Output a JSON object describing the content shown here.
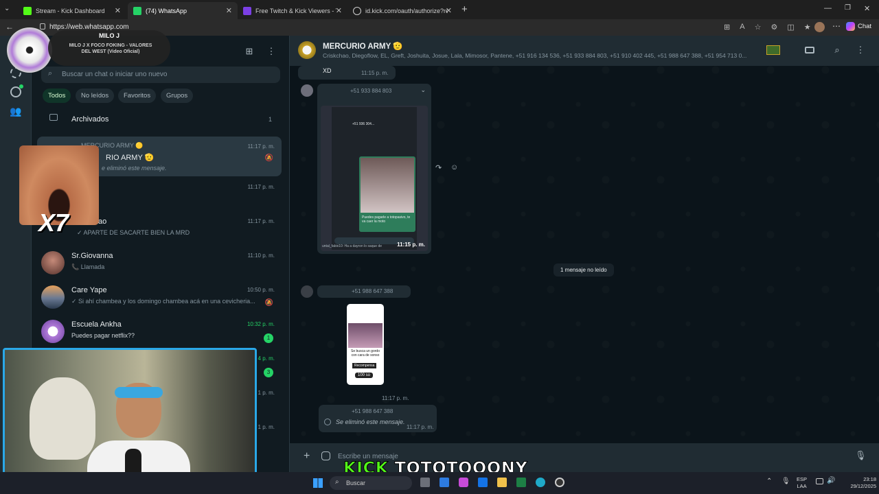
{
  "browser": {
    "tabs": [
      {
        "label": "Stream - Kick Dashboard",
        "color": "#53fc18"
      },
      {
        "label": "(74) WhatsApp",
        "color": "#25d366"
      },
      {
        "label": "Free Twitch & Kick Viewers - Try 1:",
        "color": "#7b3fe4"
      },
      {
        "label": "id.kick.com/oauth/authorize?resp",
        "color": "#cfcfcf"
      }
    ],
    "url": "https://web.whatsapp.com",
    "chat_label": "Chat"
  },
  "sidebar": {
    "search_placeholder": "Buscar un chat o iniciar uno nuevo",
    "filters": [
      "Todos",
      "No leídos",
      "Favoritos",
      "Grupos"
    ],
    "archived_label": "Archivados",
    "archived_count": "1",
    "chats": [
      {
        "group_label": "MERCURIO ARMY 🟡",
        "name": "RIO ARMY 🫡",
        "preview": "e eliminó este mensaje.",
        "time": "11:17 p. m."
      },
      {
        "name": "",
        "preview": "",
        "time": "11:17 p. m."
      },
      {
        "name": "iskchao",
        "preview": "✓ APARTE DE SACARTE BIEN LA MRD",
        "time": "11:17 p. m."
      },
      {
        "name": "Sr.Giovanna",
        "preview": "📞 Llamada",
        "time": "11:10 p. m."
      },
      {
        "name": "Care Yape",
        "preview": "✓ Si ahí chambea y los domingo chambea acá en una cevicheria...",
        "time": "10:50 p. m."
      },
      {
        "name": "Escuela Ankha",
        "preview": "Puedes pagar netflix??",
        "time": "10:32 p. m.",
        "unread": "1"
      },
      {
        "name": "",
        "preview": "",
        "time": "",
        "unread": "3",
        "time_short": "4 p. m."
      },
      {
        "name": "",
        "preview": "",
        "time": "",
        "time_short": "1 p. m."
      },
      {
        "name": "",
        "preview": "",
        "time": "",
        "time_short": "1 p. m."
      }
    ]
  },
  "conversation": {
    "title": "MERCURIO ARMY 🫡",
    "members": "Criskchao, Diegoflow, EL, Greft, Joshuita, Josue, Lala, Mimosor, Pantene, +51 916 134 536, +51 933 884 803, +51 910 402 445, +51 988 647 388, +51 954 713 0...",
    "messages": [
      {
        "text": "XD",
        "time": "11:15 p. m."
      },
      {
        "sender": "+51 933 884 803",
        "time": "11:15 p. m.",
        "caption": "Puedes pagarle a totopasivo, te va caer la moto",
        "inner_phone": "+51 936 304...",
        "inner_bottom": "untal_fabix10: Ha a dayron lo saque de"
      },
      {
        "system": "1 mensaje no leído"
      },
      {
        "sender": "+51 988 647 388",
        "time": "11:17 p. m.",
        "sticker_text": "Se busca un gordo con cara de sonso",
        "sticker_label": "Recompensa",
        "sticker_amount": "100 so"
      },
      {
        "sender": "+51 988 647 388",
        "text": "Se eliminó este mensaje.",
        "time": "11:17 p. m."
      }
    ],
    "composer_placeholder": "Escribe un mensaje"
  },
  "overlay": {
    "profile_name": "MILO J",
    "profile_song": "MILO J X FOCO FOKING - VALORES DEL WEST (Video Oficial)",
    "emote_text": "X7",
    "kick_brand": "KICK",
    "kick_user": "TOTOTOOONY"
  },
  "taskbar": {
    "search_label": "Buscar",
    "lang": "ESP",
    "lang_sub": "LAA",
    "time": "23:18",
    "date": "29/12/2025"
  }
}
